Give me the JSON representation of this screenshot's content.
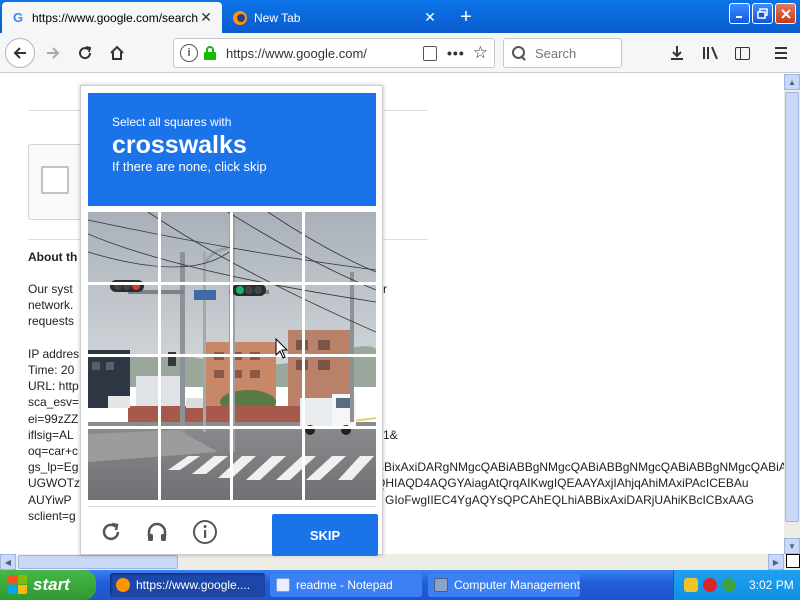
{
  "browser": {
    "tabs": [
      {
        "title": "https://www.google.com/search?q=",
        "icon": "google-favicon",
        "active": true
      },
      {
        "title": "New Tab",
        "icon": "firefox-favicon",
        "active": false
      }
    ],
    "new_tab_symbol": "+",
    "close_symbol": "✕",
    "url": "https://www.google.com/",
    "search_placeholder": "Search"
  },
  "page": {
    "about_heading": "About th",
    "text_lines": [
      "Our syst",
      "network.",
      "requests",
      "",
      "IP addres",
      "Time: 20",
      "URL: http",
      "sca_esv=",
      "ei=99zZZ",
      "iflsig=AL",
      "oq=car+c",
      "gs_lp=Eg",
      "UGWOTz",
      "AUYiwP",
      "sclient=g"
    ],
    "right_fragments": [
      {
        "text": "r",
        "line": 0
      },
      {
        "text": "1&",
        "line": 9
      },
      {
        "text": "BBixAxiDARgNMgcQABiABBgNMgcQABiABBgNMgcQABiABBgNMgcQABiABBgNMg",
        "line": 11
      },
      {
        "text": "QHIAQD4AQGYAiagAtQrqAIKwgIQEAAYAxjIAhjqAhiMAxiPAcICEBAu",
        "line": 12
      },
      {
        "text": "GIoFwgIIEC4YgAQYsQPCAhEQLhiABBixAxiDARjUAhiKBcICBxAAG",
        "line": 13
      }
    ]
  },
  "captcha": {
    "instruction": "Select all squares with",
    "keyword": "crosswalks",
    "subtext": "If there are none, click skip",
    "skip_label": "SKIP",
    "grid_size": 4
  },
  "taskbar": {
    "start_label": "start",
    "items": [
      {
        "label": "https://www.google....",
        "icon": "firefox-icon",
        "active": true
      },
      {
        "label": "readme - Notepad",
        "icon": "notepad-icon",
        "active": false
      },
      {
        "label": "Computer Management",
        "icon": "computer-management-icon",
        "active": false
      }
    ],
    "clock": "3:02 PM"
  },
  "colors": {
    "captcha_blue": "#1a73e8",
    "taskbar_blue": "#245edb",
    "start_green": "#2f9a2f"
  }
}
